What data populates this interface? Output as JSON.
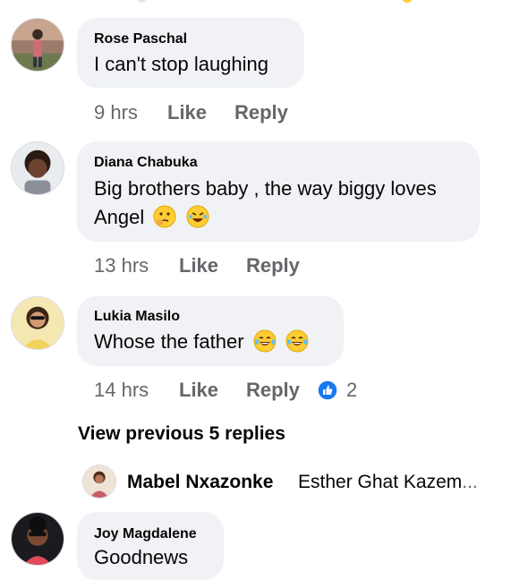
{
  "comments": [
    {
      "author": "Rose Paschal",
      "text": "I can't stop laughing",
      "time": "9 hrs",
      "like_label": "Like",
      "reply_label": "Reply"
    },
    {
      "author": "Diana Chabuka",
      "text_line1": "Big brothers baby , the way biggy loves",
      "text_line2": "Angel",
      "emojis": [
        "thinking-face-icon",
        "rofl-face-icon"
      ],
      "time": "13 hrs",
      "like_label": "Like",
      "reply_label": "Reply"
    },
    {
      "author": "Lukia Masilo",
      "text": "Whose the father",
      "emojis": [
        "laughing-tears-face-icon",
        "laughing-tears-face-icon"
      ],
      "time": "14 hrs",
      "like_label": "Like",
      "reply_label": "Reply",
      "reaction_count": "2",
      "reaction_icon": "like-reaction-icon"
    },
    {
      "author": "Joy Magdalene",
      "text": "Goodnews"
    }
  ],
  "view_previous": "View previous 5 replies",
  "latest_reply": {
    "author": "Mabel Nxazonke",
    "text": "Esther Ghat Kazem",
    "ellipsis": "..."
  },
  "colors": {
    "bubble": "#f0f2f5",
    "meta_text": "#65676b",
    "like_blue": "#1877f2",
    "emoji_yellow": "#ffcc33"
  }
}
